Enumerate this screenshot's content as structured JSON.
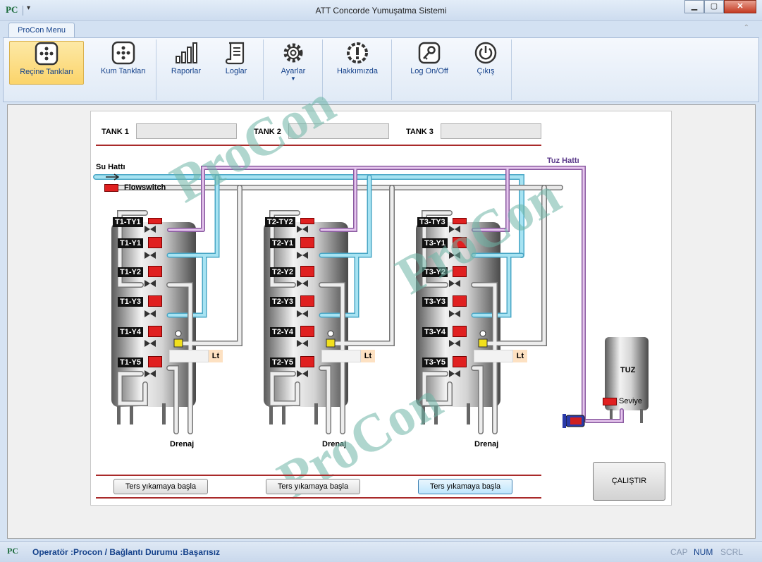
{
  "window": {
    "title": "ATT Concorde Yumuşatma Sistemi",
    "app_icon": "PC"
  },
  "ribbon": {
    "tab": "ProCon Menu",
    "buttons": [
      {
        "label": "Reçine Tankları",
        "icon": "tank-grid-icon"
      },
      {
        "label": "Kum Tankları",
        "icon": "tank-grid-icon"
      },
      {
        "label": "Raporlar",
        "icon": "bar-chart-icon"
      },
      {
        "label": "Loglar",
        "icon": "scroll-icon"
      },
      {
        "label": "Ayarlar",
        "icon": "gear-icon"
      },
      {
        "label": "Hakkımızda",
        "icon": "info-badge-icon"
      },
      {
        "label": "Log On/Off",
        "icon": "key-icon"
      },
      {
        "label": "Çıkış",
        "icon": "power-icon"
      }
    ]
  },
  "tanks": {
    "t1": "TANK 1",
    "t2": "TANK 2",
    "t3": "TANK 3"
  },
  "diagram": {
    "water_line": "Su Hattı",
    "salt_line": "Tuz Hattı",
    "flowswitch": "Flowswitch",
    "drain": "Drenaj",
    "lt": "Lt",
    "salt_tank": "TUZ",
    "level": "Seviye",
    "valves": {
      "t1": [
        "T1-TY1",
        "T1-Y1",
        "T1-Y2",
        "T1-Y3",
        "T1-Y4",
        "T1-Y5"
      ],
      "t2": [
        "T2-TY2",
        "T2-Y1",
        "T2-Y2",
        "T2-Y3",
        "T2-Y4",
        "T2-Y5"
      ],
      "t3": [
        "T3-TY3",
        "T3-Y1",
        "T3-Y2",
        "T3-Y3",
        "T3-Y4",
        "T3-Y5"
      ]
    }
  },
  "buttons": {
    "backwash": "Ters yıkamaya başla",
    "run": "ÇALIŞTIR"
  },
  "watermark": "ProCon",
  "status": {
    "text": "Operatör :Procon / Bağlantı Durumu :Başarısız",
    "cap": "CAP",
    "num": "NUM",
    "scrl": "SCRL"
  },
  "colors": {
    "water_pipe": "#8fd6ea",
    "salt_pipe": "#b98ccc",
    "valve_indicator": "#e02020",
    "alarm_line": "#a92a2a"
  }
}
